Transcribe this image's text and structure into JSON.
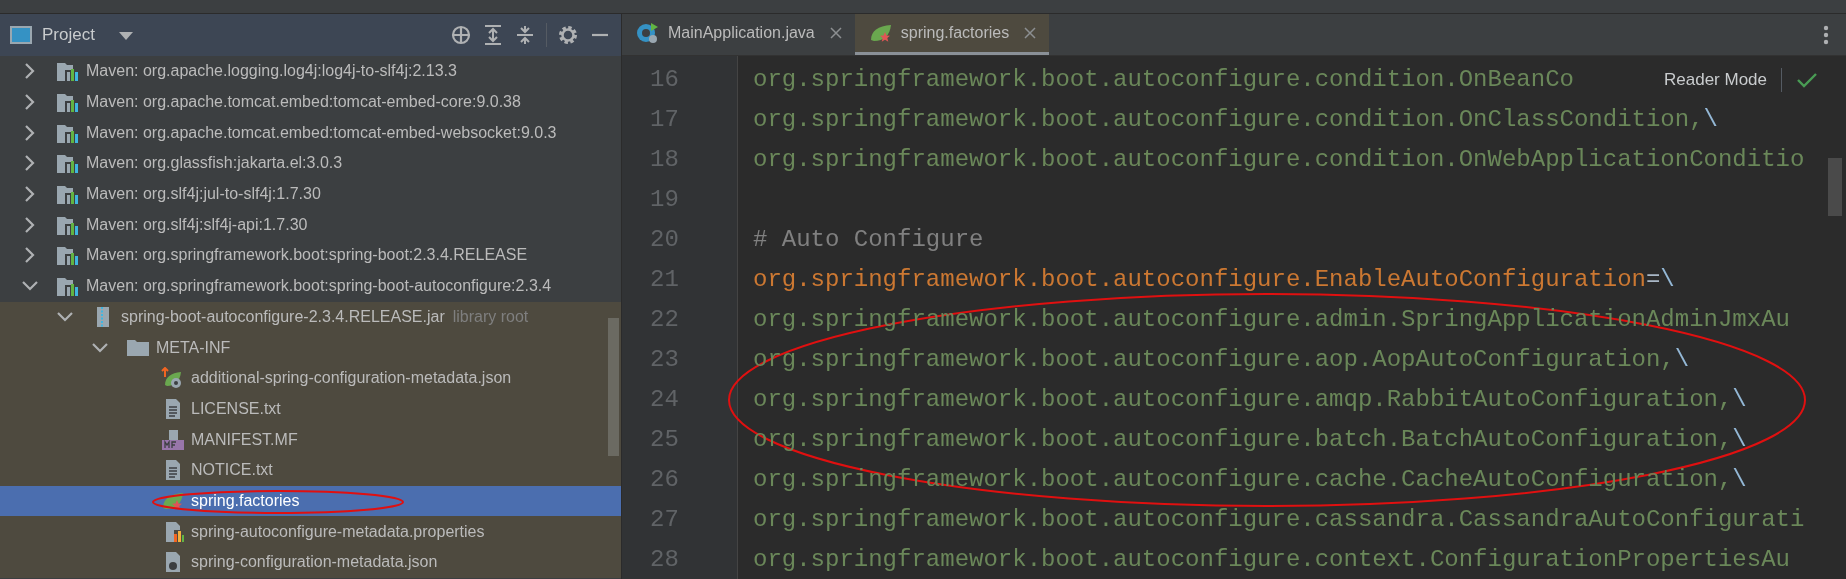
{
  "project_panel": {
    "title": "Project",
    "tree": [
      {
        "label": "Maven: org.apache.logging.log4j:log4j-to-slf4j:2.13.3",
        "kind": "maven-library",
        "expanded": false,
        "selected": false
      },
      {
        "label": "Maven: org.apache.tomcat.embed:tomcat-embed-core:9.0.38",
        "kind": "maven-library",
        "expanded": false,
        "selected": false
      },
      {
        "label": "Maven: org.apache.tomcat.embed:tomcat-embed-websocket:9.0.3",
        "kind": "maven-library",
        "expanded": false,
        "selected": false
      },
      {
        "label": "Maven: org.glassfish:jakarta.el:3.0.3",
        "kind": "maven-library",
        "expanded": false,
        "selected": false
      },
      {
        "label": "Maven: org.slf4j:jul-to-slf4j:1.7.30",
        "kind": "maven-library",
        "expanded": false,
        "selected": false
      },
      {
        "label": "Maven: org.slf4j:slf4j-api:1.7.30",
        "kind": "maven-library",
        "expanded": false,
        "selected": false
      },
      {
        "label": "Maven: org.springframework.boot:spring-boot:2.3.4.RELEASE",
        "kind": "maven-library",
        "expanded": false,
        "selected": false
      },
      {
        "label": "Maven: org.springframework.boot:spring-boot-autoconfigure:2.3.4",
        "kind": "maven-library",
        "expanded": true,
        "selected": false,
        "children": [
          {
            "label": "spring-boot-autoconfigure-2.3.4.RELEASE.jar",
            "hint": "library root",
            "kind": "jar",
            "expanded": true,
            "selected": false,
            "children": [
              {
                "label": "META-INF",
                "kind": "folder",
                "expanded": true,
                "selected": false,
                "children": [
                  {
                    "label": "additional-spring-configuration-metadata.json",
                    "kind": "spring-metadata",
                    "selected": false
                  },
                  {
                    "label": "LICENSE.txt",
                    "kind": "text-file",
                    "selected": false
                  },
                  {
                    "label": "MANIFEST.MF",
                    "kind": "manifest",
                    "selected": false
                  },
                  {
                    "label": "NOTICE.txt",
                    "kind": "text-file",
                    "selected": false
                  },
                  {
                    "label": "spring.factories",
                    "kind": "spring-factories",
                    "selected": true,
                    "circled": true
                  },
                  {
                    "label": "spring-autoconfigure-metadata.properties",
                    "kind": "properties",
                    "selected": false
                  },
                  {
                    "label": "spring-configuration-metadata.json",
                    "kind": "json-config",
                    "selected": false
                  }
                ]
              }
            ]
          }
        ]
      }
    ]
  },
  "editor": {
    "tabs": [
      {
        "label": "MainApplication.java",
        "kind": "java-class",
        "selected": false
      },
      {
        "label": "spring.factories",
        "kind": "spring-factories",
        "selected": true
      }
    ],
    "reader_mode": "Reader Mode",
    "lines": [
      {
        "number": "16",
        "segments": [
          {
            "kind": "value",
            "text": "org.springframework.boot.autoconfigure.condition.OnBeanCo"
          }
        ]
      },
      {
        "number": "17",
        "segments": [
          {
            "kind": "value",
            "text": "org.springframework.boot.autoconfigure.condition.OnClassCondition,"
          },
          {
            "kind": "escape",
            "text": "\\"
          }
        ]
      },
      {
        "number": "18",
        "segments": [
          {
            "kind": "value",
            "text": "org.springframework.boot.autoconfigure.condition.OnWebApplicationConditio"
          }
        ]
      },
      {
        "number": "19"
      },
      {
        "number": "20",
        "segments": [
          {
            "kind": "comment",
            "text": "# Auto Configure"
          }
        ]
      },
      {
        "number": "21",
        "segments": [
          {
            "kind": "key",
            "text": "org.springframework.boot.autoconfigure.EnableAutoConfiguration"
          },
          {
            "kind": "operator",
            "text": "="
          },
          {
            "kind": "escape",
            "text": "\\"
          }
        ]
      },
      {
        "number": "22",
        "circled": true,
        "segments": [
          {
            "kind": "value",
            "text": "org.springframework.boot.autoconfigure.admin.SpringApplicationAdminJmxAu"
          }
        ]
      },
      {
        "number": "23",
        "circled": true,
        "segments": [
          {
            "kind": "value",
            "text": "org.springframework.boot.autoconfigure.aop.AopAutoConfiguration,"
          },
          {
            "kind": "escape",
            "text": "\\"
          }
        ]
      },
      {
        "number": "24",
        "circled": true,
        "segments": [
          {
            "kind": "value",
            "text": "org.springframework.boot.autoconfigure.amqp.RabbitAutoConfiguration,"
          },
          {
            "kind": "escape",
            "text": "\\"
          }
        ]
      },
      {
        "number": "25",
        "circled": true,
        "segments": [
          {
            "kind": "value",
            "text": "org.springframework.boot.autoconfigure.batch.BatchAutoConfiguration,"
          },
          {
            "kind": "escape",
            "text": "\\"
          }
        ]
      },
      {
        "number": "26",
        "circled": true,
        "segments": [
          {
            "kind": "value",
            "text": "org.springframework.boot.autoconfigure.cache.CacheAutoConfiguration,"
          },
          {
            "kind": "escape",
            "text": "\\"
          }
        ]
      },
      {
        "number": "27",
        "segments": [
          {
            "kind": "value",
            "text": "org.springframework.boot.autoconfigure.cassandra.CassandraAutoConfigurati"
          }
        ]
      },
      {
        "number": "28",
        "segments": [
          {
            "kind": "value",
            "text": "org.springframework.boot.autoconfigure.context.ConfigurationPropertiesAu"
          }
        ]
      }
    ]
  }
}
